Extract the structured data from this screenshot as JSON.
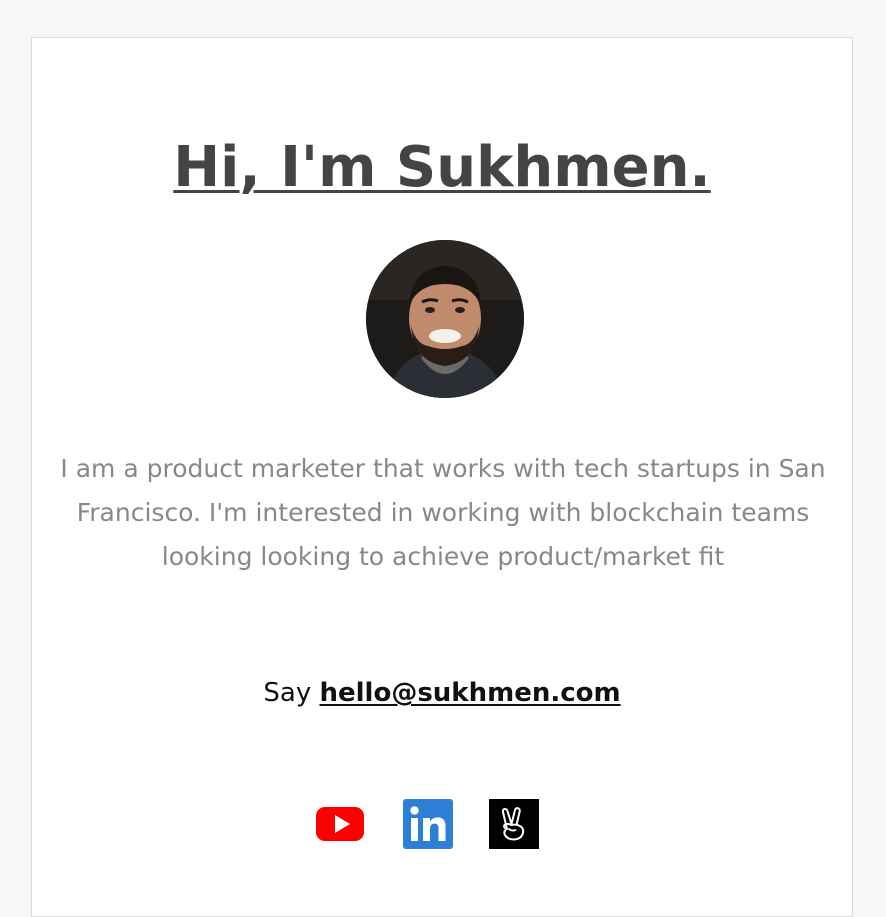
{
  "header": {
    "title": "Hi, I'm Sukhmen."
  },
  "profile": {
    "avatar_icon": "portrait-photo"
  },
  "bio": {
    "text": "I am a product marketer that works with tech startups in San Francisco. I'm interested in working with blockchain teams looking looking to achieve product/market fit"
  },
  "contact": {
    "prefix": "Say ",
    "email": "hello@sukhmen.com"
  },
  "socials": [
    {
      "icon": "youtube-icon",
      "color": "#ff0000"
    },
    {
      "icon": "linkedin-icon",
      "color": "#2d7fd6"
    },
    {
      "icon": "angellist-icon",
      "color": "#000000"
    }
  ]
}
